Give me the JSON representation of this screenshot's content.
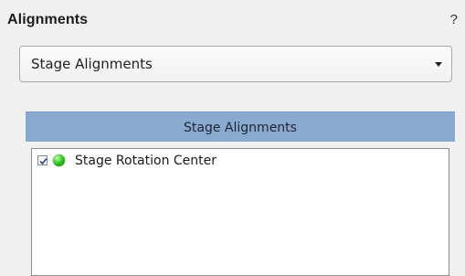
{
  "panel": {
    "title": "Alignments",
    "help_label": "?"
  },
  "dropdown": {
    "selected": "Stage Alignments",
    "icon": "chevron-down-icon"
  },
  "group": {
    "header": "Stage Alignments",
    "items": [
      {
        "label": "Stage Rotation Center",
        "checked": true,
        "status_color": "#2fb81f",
        "status_icon": "status-green-icon"
      }
    ]
  },
  "colors": {
    "header_background": "#8aa9cf",
    "panel_background": "#f0f0f0"
  }
}
